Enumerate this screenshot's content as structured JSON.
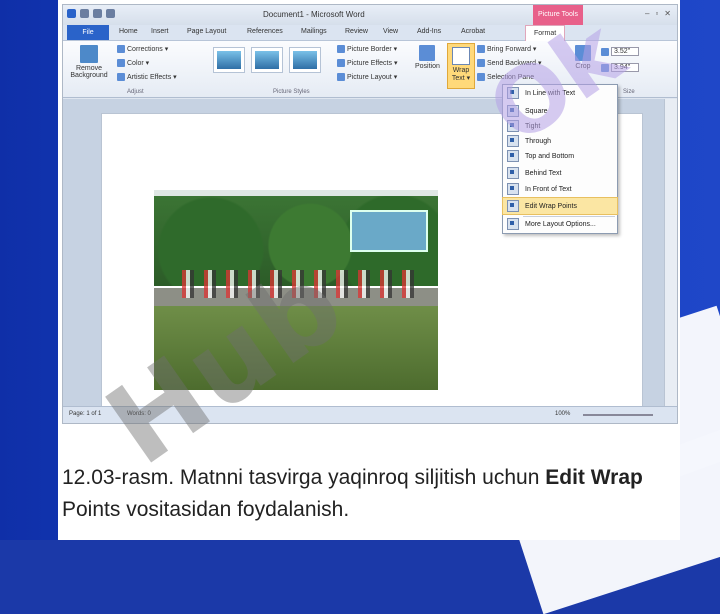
{
  "word": {
    "title": "Document1 - Microsoft Word",
    "picture_tools": "Picture Tools",
    "window_controls": [
      "–",
      "▫",
      "✕"
    ],
    "tabs": [
      "File",
      "Home",
      "Insert",
      "Page Layout",
      "References",
      "Mailings",
      "Review",
      "View",
      "Add-Ins",
      "Acrobat",
      "Format"
    ],
    "ribbon": {
      "remove_background": "Remove Background",
      "adjust": [
        "Corrections ▾",
        "Color ▾",
        "Artistic Effects ▾"
      ],
      "adjust_label": "Adjust",
      "picture_styles_label": "Picture Styles",
      "picture_options": [
        "Picture Border ▾",
        "Picture Effects ▾",
        "Picture Layout ▾"
      ],
      "position": "Position",
      "wrap_text": "Wrap Text ▾",
      "arrange": [
        "Bring Forward ▾",
        "Send Backward ▾",
        "Selection Pane"
      ],
      "crop": "Crop",
      "height": "3.52\"",
      "width": "3.94\"",
      "size_label": "Size"
    },
    "wrap_menu": [
      "In Line with Text",
      "Square",
      "Tight",
      "Through",
      "Top and Bottom",
      "Behind Text",
      "In Front of Text",
      "Edit Wrap Points",
      "More Layout Options..."
    ],
    "wrap_menu_highlight_index": 7,
    "status": {
      "page": "Page: 1 of 1",
      "words": "Words: 0",
      "zoom": "100%"
    }
  },
  "watermark": {
    "text1": "Hub",
    "text2": "Ok"
  },
  "caption": {
    "prefix": "12.03-rasm. Matnni tasvirga yaqinroq siljitish uchun ",
    "bold1": "Edit Wrap",
    "suffix": " Points vositasidan foydalanish."
  },
  "colors": {
    "background": "#1b39a8",
    "file_tab": "#2a63c9",
    "picture_tools": "#e8608a",
    "menu_highlight": "#fbe6a3"
  }
}
